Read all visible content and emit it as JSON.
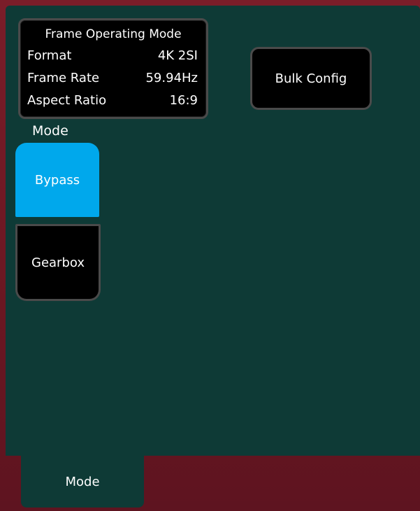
{
  "info_box": {
    "title": "Frame Operating Mode",
    "rows": [
      {
        "label": "Format",
        "value": "4K 2SI"
      },
      {
        "label": "Frame Rate",
        "value": "59.94Hz"
      },
      {
        "label": "Aspect Ratio",
        "value": "16:9"
      }
    ]
  },
  "bulk_config": {
    "label": "Bulk Config"
  },
  "mode": {
    "label": "Mode",
    "options": [
      {
        "label": "Bypass",
        "selected": true
      },
      {
        "label": "Gearbox",
        "selected": false
      }
    ]
  },
  "tabs": [
    {
      "label": "Mode",
      "active": true
    }
  ],
  "colors": {
    "panel": "#0e3a36",
    "selected": "#00a8ec",
    "button": "#000000",
    "frame": "#6b1a25"
  }
}
